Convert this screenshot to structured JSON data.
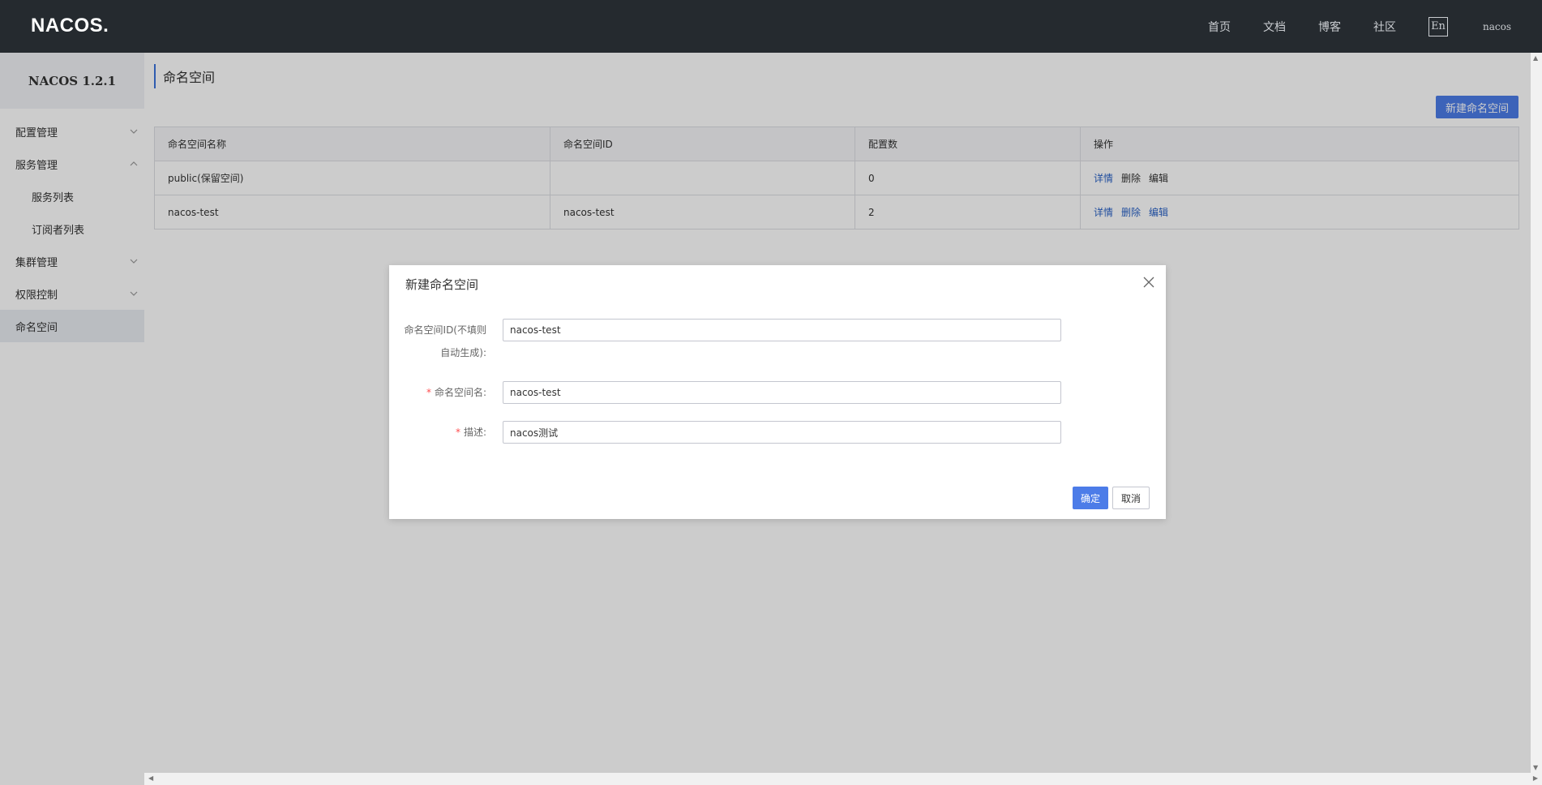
{
  "header": {
    "logo": "NACOS.",
    "nav": [
      "首页",
      "文档",
      "博客",
      "社区"
    ],
    "lang": "En",
    "user": "nacos"
  },
  "sidebar": {
    "version": "NACOS 1.2.1",
    "items": [
      {
        "label": "配置管理",
        "expanded": false
      },
      {
        "label": "服务管理",
        "expanded": true
      },
      {
        "label": "服务列表"
      },
      {
        "label": "订阅者列表"
      },
      {
        "label": "集群管理",
        "expanded": false
      },
      {
        "label": "权限控制",
        "expanded": false
      },
      {
        "label": "命名空间",
        "active": true
      }
    ]
  },
  "main": {
    "title": "命名空间",
    "new_button": "新建命名空间",
    "table": {
      "headers": [
        "命名空间名称",
        "命名空间ID",
        "配置数",
        "操作"
      ],
      "rows": [
        {
          "name": "public(保留空间)",
          "id": "",
          "count": "0"
        },
        {
          "name": "nacos-test",
          "id": "nacos-test",
          "count": "2"
        }
      ],
      "actions": [
        "详情",
        "删除",
        "编辑"
      ]
    }
  },
  "dialog": {
    "title": "新建命名空间",
    "fields": {
      "id_label_1": "命名空间ID(不填则",
      "id_label_2": "自动生成):",
      "id_value": "nacos-test",
      "name_label": "命名空间名:",
      "name_value": "nacos-test",
      "desc_label": "描述:",
      "desc_value": "nacos测试",
      "required_mark": "*"
    },
    "ok": "确定",
    "cancel": "取消"
  },
  "colors": {
    "header_bg": "#252a2f",
    "primary": "#4c7ce8",
    "link": "#2a62c6",
    "required": "#ff4d4f"
  }
}
